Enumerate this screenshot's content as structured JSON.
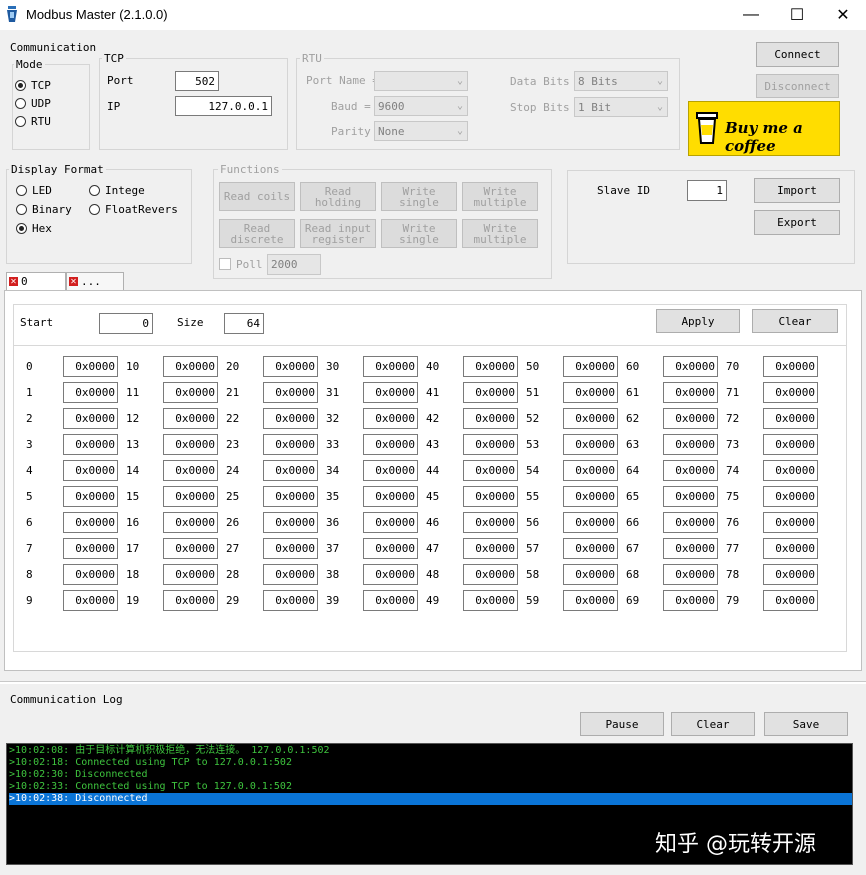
{
  "window": {
    "title": "Modbus Master (2.1.0.0)",
    "minimize": "—",
    "maximize": "☐",
    "close": "✕"
  },
  "communication": {
    "label": "Communication",
    "mode_label": "Mode",
    "modes": [
      "TCP",
      "UDP",
      "RTU"
    ],
    "selected_mode": "TCP",
    "tcp": {
      "label": "TCP",
      "port_label": "Port",
      "port": "502",
      "ip_label": "IP",
      "ip": "127.0.0.1"
    },
    "rtu": {
      "label": "RTU",
      "port_name_label": "Port Name =",
      "port_name": "",
      "baud_label": "Baud =",
      "baud": "9600",
      "parity_label": "Parity",
      "parity": "None",
      "data_bits_label": "Data Bits =",
      "data_bits": "8 Bits",
      "stop_bits_label": "Stop Bits =",
      "stop_bits": "1 Bit"
    }
  },
  "buttons": {
    "connect": "Connect",
    "disconnect": "Disconnect",
    "import": "Import",
    "export": "Export",
    "apply": "Apply",
    "clear": "Clear",
    "pause": "Pause",
    "log_clear": "Clear",
    "save": "Save"
  },
  "coffee": {
    "label": "Buy me a coffee",
    "bg": "#ffdd00"
  },
  "display_format": {
    "label": "Display Format",
    "options": [
      "LED",
      "Binary",
      "Hex",
      "Intege",
      "FloatRevers"
    ],
    "selected": "Hex"
  },
  "functions": {
    "label": "Functions",
    "buttons": [
      "Read coils",
      "Read holding",
      "Write single",
      "Write multiple",
      "Read discrete",
      "Read input register",
      "Write single",
      "Write multiple"
    ],
    "poll_label": "Poll",
    "poll_value": "2000"
  },
  "slave": {
    "label": "Slave ID",
    "value": "1"
  },
  "tabs": [
    "0",
    "..."
  ],
  "registers": {
    "start_label": "Start",
    "start": "0",
    "size_label": "Size",
    "size": "64",
    "rows": [
      [
        {
          "a": "0",
          "v": "0x0000"
        },
        {
          "a": "10",
          "v": "0x0000"
        },
        {
          "a": "20",
          "v": "0x0000"
        },
        {
          "a": "30",
          "v": "0x0000"
        },
        {
          "a": "40",
          "v": "0x0000"
        },
        {
          "a": "50",
          "v": "0x0000"
        },
        {
          "a": "60",
          "v": "0x0000"
        },
        {
          "a": "70",
          "v": "0x0000"
        }
      ],
      [
        {
          "a": "1",
          "v": "0x0000"
        },
        {
          "a": "11",
          "v": "0x0000"
        },
        {
          "a": "21",
          "v": "0x0000"
        },
        {
          "a": "31",
          "v": "0x0000"
        },
        {
          "a": "41",
          "v": "0x0000"
        },
        {
          "a": "51",
          "v": "0x0000"
        },
        {
          "a": "61",
          "v": "0x0000"
        },
        {
          "a": "71",
          "v": "0x0000"
        }
      ],
      [
        {
          "a": "2",
          "v": "0x0000"
        },
        {
          "a": "12",
          "v": "0x0000"
        },
        {
          "a": "22",
          "v": "0x0000"
        },
        {
          "a": "32",
          "v": "0x0000"
        },
        {
          "a": "42",
          "v": "0x0000"
        },
        {
          "a": "52",
          "v": "0x0000"
        },
        {
          "a": "62",
          "v": "0x0000"
        },
        {
          "a": "72",
          "v": "0x0000"
        }
      ],
      [
        {
          "a": "3",
          "v": "0x0000"
        },
        {
          "a": "13",
          "v": "0x0000"
        },
        {
          "a": "23",
          "v": "0x0000"
        },
        {
          "a": "33",
          "v": "0x0000"
        },
        {
          "a": "43",
          "v": "0x0000"
        },
        {
          "a": "53",
          "v": "0x0000"
        },
        {
          "a": "63",
          "v": "0x0000"
        },
        {
          "a": "73",
          "v": "0x0000"
        }
      ],
      [
        {
          "a": "4",
          "v": "0x0000"
        },
        {
          "a": "14",
          "v": "0x0000"
        },
        {
          "a": "24",
          "v": "0x0000"
        },
        {
          "a": "34",
          "v": "0x0000"
        },
        {
          "a": "44",
          "v": "0x0000"
        },
        {
          "a": "54",
          "v": "0x0000"
        },
        {
          "a": "64",
          "v": "0x0000"
        },
        {
          "a": "74",
          "v": "0x0000"
        }
      ],
      [
        {
          "a": "5",
          "v": "0x0000"
        },
        {
          "a": "15",
          "v": "0x0000"
        },
        {
          "a": "25",
          "v": "0x0000"
        },
        {
          "a": "35",
          "v": "0x0000"
        },
        {
          "a": "45",
          "v": "0x0000"
        },
        {
          "a": "55",
          "v": "0x0000"
        },
        {
          "a": "65",
          "v": "0x0000"
        },
        {
          "a": "75",
          "v": "0x0000"
        }
      ],
      [
        {
          "a": "6",
          "v": "0x0000"
        },
        {
          "a": "16",
          "v": "0x0000"
        },
        {
          "a": "26",
          "v": "0x0000"
        },
        {
          "a": "36",
          "v": "0x0000"
        },
        {
          "a": "46",
          "v": "0x0000"
        },
        {
          "a": "56",
          "v": "0x0000"
        },
        {
          "a": "66",
          "v": "0x0000"
        },
        {
          "a": "76",
          "v": "0x0000"
        }
      ],
      [
        {
          "a": "7",
          "v": "0x0000"
        },
        {
          "a": "17",
          "v": "0x0000"
        },
        {
          "a": "27",
          "v": "0x0000"
        },
        {
          "a": "37",
          "v": "0x0000"
        },
        {
          "a": "47",
          "v": "0x0000"
        },
        {
          "a": "57",
          "v": "0x0000"
        },
        {
          "a": "67",
          "v": "0x0000"
        },
        {
          "a": "77",
          "v": "0x0000"
        }
      ],
      [
        {
          "a": "8",
          "v": "0x0000"
        },
        {
          "a": "18",
          "v": "0x0000"
        },
        {
          "a": "28",
          "v": "0x0000"
        },
        {
          "a": "38",
          "v": "0x0000"
        },
        {
          "a": "48",
          "v": "0x0000"
        },
        {
          "a": "58",
          "v": "0x0000"
        },
        {
          "a": "68",
          "v": "0x0000"
        },
        {
          "a": "78",
          "v": "0x0000"
        }
      ],
      [
        {
          "a": "9",
          "v": "0x0000"
        },
        {
          "a": "19",
          "v": "0x0000"
        },
        {
          "a": "29",
          "v": "0x0000"
        },
        {
          "a": "39",
          "v": "0x0000"
        },
        {
          "a": "49",
          "v": "0x0000"
        },
        {
          "a": "59",
          "v": "0x0000"
        },
        {
          "a": "69",
          "v": "0x0000"
        },
        {
          "a": "79",
          "v": "0x0000"
        }
      ]
    ]
  },
  "log": {
    "label": "Communication Log",
    "lines": [
      ">10:02:08: 由于目标计算机积极拒绝，无法连接。 127.0.0.1:502",
      ">10:02:18: Connected using TCP to 127.0.0.1:502",
      ">10:02:30: Disconnected",
      ">10:02:33: Connected using TCP to 127.0.0.1:502",
      ">10:02:38: Disconnected"
    ],
    "selected_index": 4
  },
  "watermark": "知乎 @玩转开源"
}
